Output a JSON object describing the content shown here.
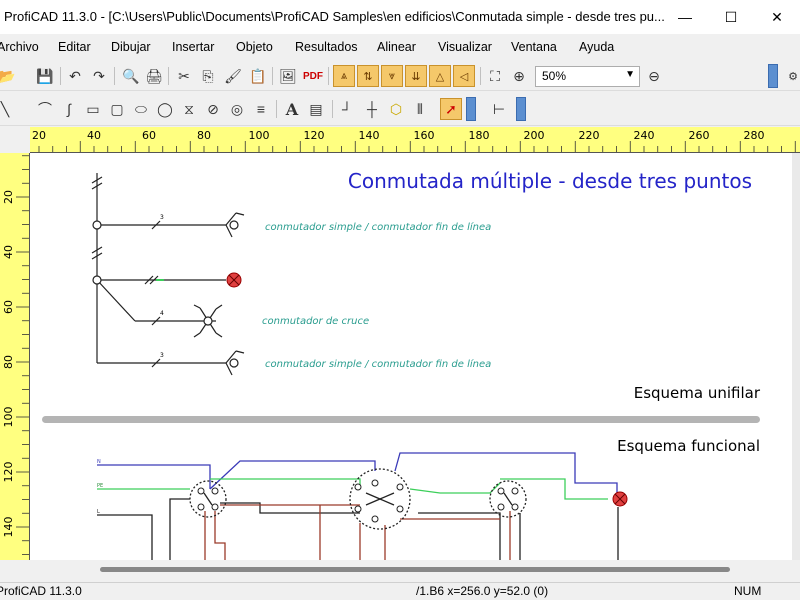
{
  "window": {
    "title": "ProfiCAD 11.3.0 - [C:\\Users\\Public\\Documents\\ProfiCAD Samples\\en edificios\\Conmutada simple - desde tres pu...",
    "minimize_glyph": "—",
    "maximize_glyph": "☐",
    "close_glyph": "✕"
  },
  "menu": {
    "items": [
      "Archivo",
      "Editar",
      "Dibujar",
      "Insertar",
      "Objeto",
      "Resultados",
      "Alinear",
      "Visualizar",
      "Ventana",
      "Ayuda"
    ]
  },
  "toolbar_main": {
    "pdf_label": "PDF",
    "zoom_value": "50%"
  },
  "toolbar_draw": {
    "text_tool": "A"
  },
  "ruler": {
    "h_ticks": [
      "20",
      "40",
      "60",
      "80",
      "100",
      "120",
      "140",
      "160",
      "180",
      "200",
      "220",
      "240",
      "260",
      "280"
    ],
    "v_ticks": [
      "20",
      "40",
      "60",
      "80",
      "100",
      "120",
      "140"
    ]
  },
  "drawing": {
    "title": "Conmutada múltiple - desde tres puntos",
    "note_1": "conmutador simple / conmutador fin de línea",
    "note_2": "conmutador de cruce",
    "note_3": "conmutador simple / conmutador fin de línea",
    "section_unifilar": "Esquema unifilar",
    "section_funcional": "Esquema funcional",
    "wire_n": "N",
    "wire_pe": "PE",
    "wire_l": "L",
    "count_3a": "3",
    "count_4": "4",
    "count_3b": "3"
  },
  "status": {
    "app": "ProfiCAD 11.3.0",
    "coords": "/1.B6  x=256.0  y=52.0 (0)",
    "num": "NUM"
  },
  "colors": {
    "title_blue": "#2424c8",
    "note_teal": "#2a9d8f",
    "ruler_yellow": "#ffff80",
    "wire_blue": "#3a3ab8",
    "wire_green": "#3ccf5a",
    "wire_brown": "#9a3a2a",
    "lamp_red": "#e04040"
  }
}
